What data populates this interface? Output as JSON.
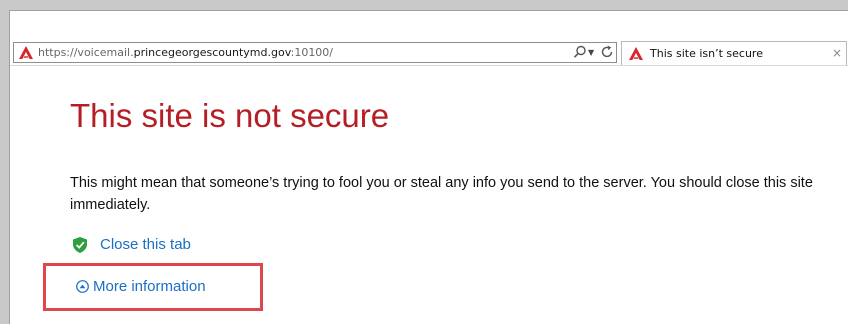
{
  "browser": {
    "address_bar": {
      "url_prefix": "https://voicemail.",
      "url_domain": "princegeorgescountymd.gov",
      "url_suffix": ":10100/",
      "search_icon": "search-icon",
      "dropdown_icon": "chevron-down-icon",
      "refresh_icon": "refresh-icon"
    },
    "tab": {
      "title": "This site isn’t secure",
      "close_glyph": "×",
      "icon": "warning-icon"
    }
  },
  "page": {
    "heading": "This site is not secure",
    "description": "This might mean that someone’s trying to fool you or steal any info you send to the server. You should close this site immediately.",
    "close_tab_label": "Close this tab",
    "more_info_label": "More information",
    "close_tab_icon": "shield-check-icon",
    "more_info_icon": "expand-circle-icon"
  },
  "colors": {
    "heading": "#b41e24",
    "link": "#1a6fc4",
    "warning": "#d9252b",
    "highlight": "#e0474c",
    "shield": "#2e9e3e"
  }
}
